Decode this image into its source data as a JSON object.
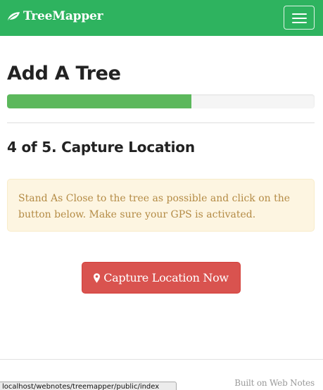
{
  "navbar": {
    "brand": "TreeMapper",
    "brand_icon": "leaf-icon",
    "menu_icon": "hamburger-menu-icon",
    "color": "#2eb35f"
  },
  "page": {
    "title": "Add A Tree",
    "progress_percent": 60,
    "progress_color": "#5cb85c",
    "step_heading": "4 of 5. Capture Location",
    "instruction": "Stand As Close to the tree as possible and click on the button below. Make sure your GPS is activated.",
    "capture_button": {
      "label": "Capture Location Now",
      "icon": "map-marker-icon",
      "color": "#d9534f"
    }
  },
  "footer": {
    "credit": "Built on Web Notes"
  },
  "status_bar": {
    "url": "localhost/webnotes/treemapper/public/index"
  }
}
